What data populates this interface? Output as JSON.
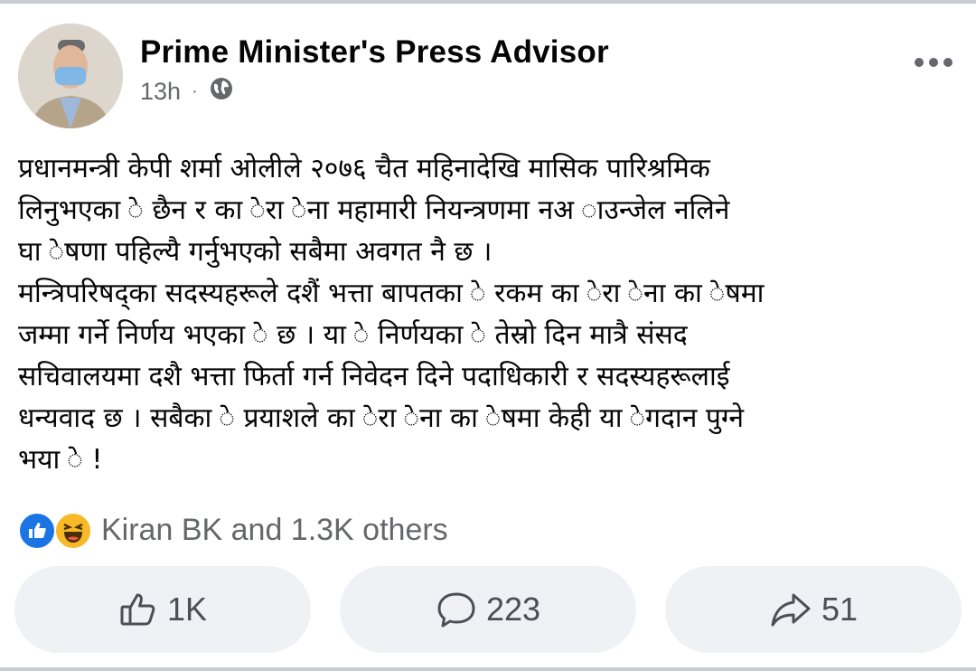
{
  "post": {
    "author": "Prime Minister's Press Advisor",
    "time": "13h",
    "separator": "·",
    "privacy_icon": "globe-icon",
    "more_icon": "more-options-icon",
    "text": "प्रधानमन्त्री  केपी शर्मा ओलीले २०७६ चैत महिनादेखि मासिक पारिश्रमिक\nलिनुभएका े छैन र का ेरा ेना महामारी नियन्त्रणमा नअ ाउन्जेल नलिने\nघा ेषणा पहिल्यै गर्नुभएको सबैमा अवगत नै छ ।\nमन्त्रिपरिषद्का सदस्यहरूले दशैं भत्ता बापतका े रकम का ेरा ेना का ेषमा\nजम्मा गर्ने निर्णय भएका े छ । या े निर्णयका े तेस्रो दिन मात्रै संसद\nसचिवालयमा दशै भत्ता फिर्ता गर्न निवेदन दिने पदाधिकारी र सदस्यहरूलाई\nधन्यवाद छ । सबैका े प्रयाशले का ेरा ेना का ेषमा केही या ेगदान पुग्ने\nभया े !",
    "reactions": {
      "icons": [
        "like-reaction-icon",
        "haha-reaction-icon"
      ],
      "summary": "Kiran BK and 1.3K others"
    },
    "actions": {
      "like_count": "1K",
      "comment_count": "223",
      "share_count": "51"
    }
  },
  "colors": {
    "like_blue": "#1b74e4",
    "haha_yellow": "#f7b928",
    "secondary_text": "#65676b",
    "button_bg": "#eff1f4"
  }
}
